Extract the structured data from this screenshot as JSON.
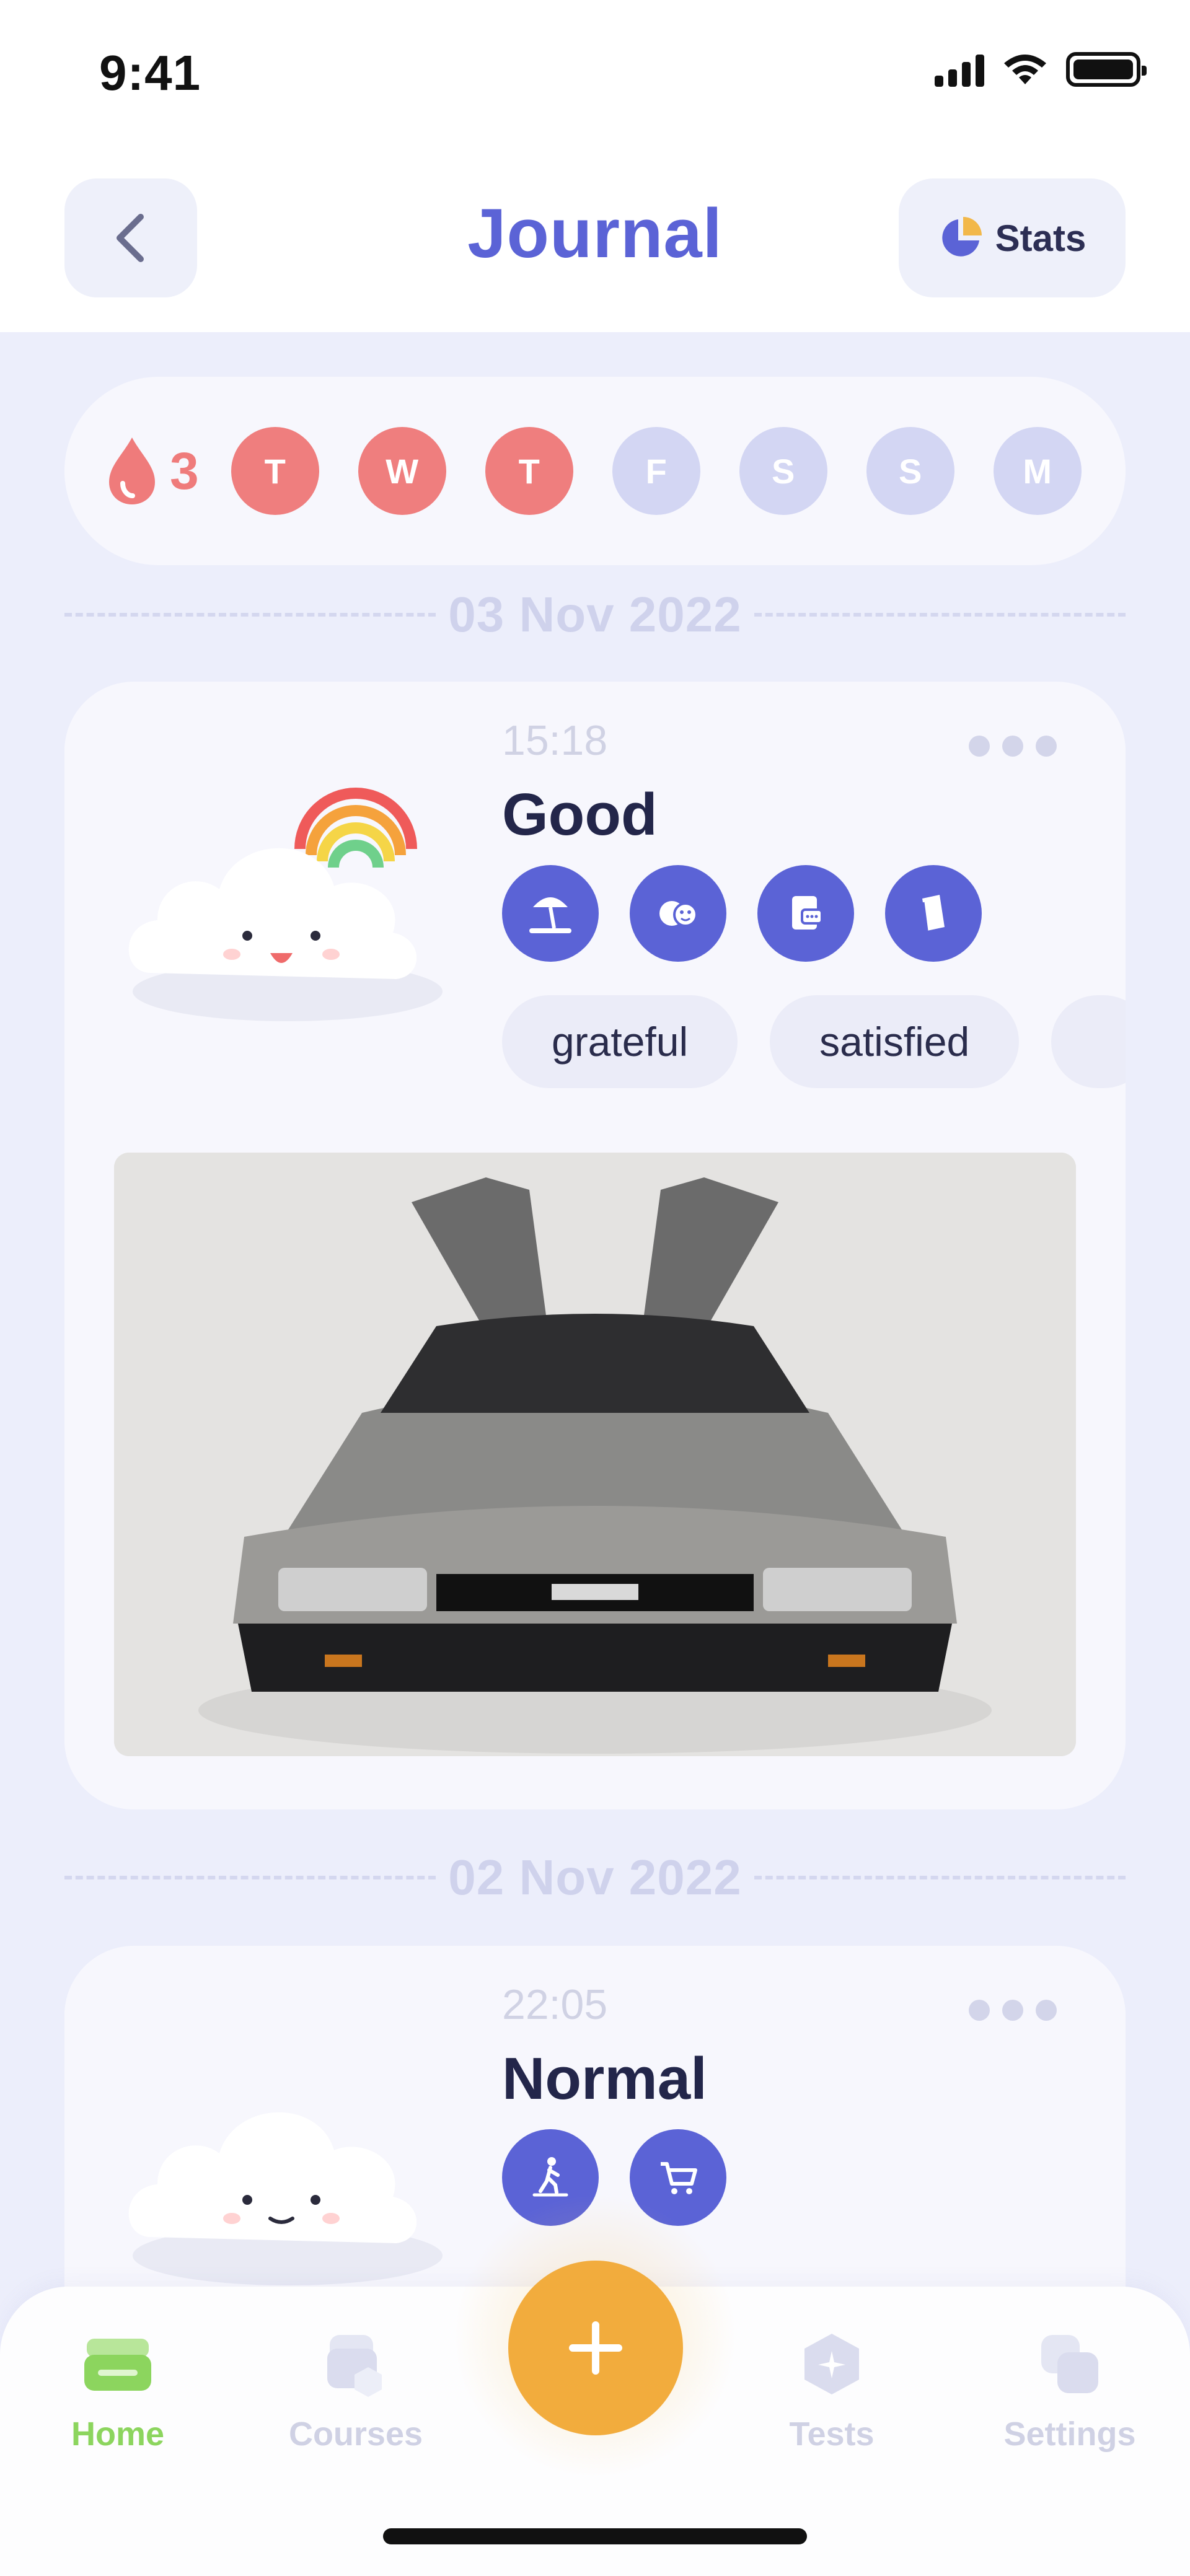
{
  "status_bar": {
    "time": "9:41"
  },
  "header": {
    "title": "Journal",
    "stats_label": "Stats"
  },
  "streak": {
    "count": "3",
    "days": [
      {
        "letter": "T",
        "done": true
      },
      {
        "letter": "W",
        "done": true
      },
      {
        "letter": "T",
        "done": true
      },
      {
        "letter": "F",
        "done": false
      },
      {
        "letter": "S",
        "done": false
      },
      {
        "letter": "S",
        "done": false
      },
      {
        "letter": "M",
        "done": false
      }
    ]
  },
  "entries": [
    {
      "date": "03 Nov 2022",
      "time": "15:18",
      "mood": "Good",
      "activities": [
        "beach-icon",
        "emotions-icon",
        "chat-icon",
        "book-icon"
      ],
      "feelings": [
        "grateful",
        "satisfied"
      ]
    },
    {
      "date": "02 Nov 2022",
      "time": "22:05",
      "mood": "Normal",
      "activities": [
        "walking-icon",
        "shopping-cart-icon"
      ]
    }
  ],
  "tabs": {
    "home": "Home",
    "courses": "Courses",
    "tests": "Tests",
    "settings": "Settings"
  },
  "colors": {
    "accent": "#5b63d6",
    "streak_done": "#ef7e7e",
    "streak_todo": "#d3d6f3",
    "fab": "#f2ac3d",
    "active_tab": "#8cd55e"
  }
}
